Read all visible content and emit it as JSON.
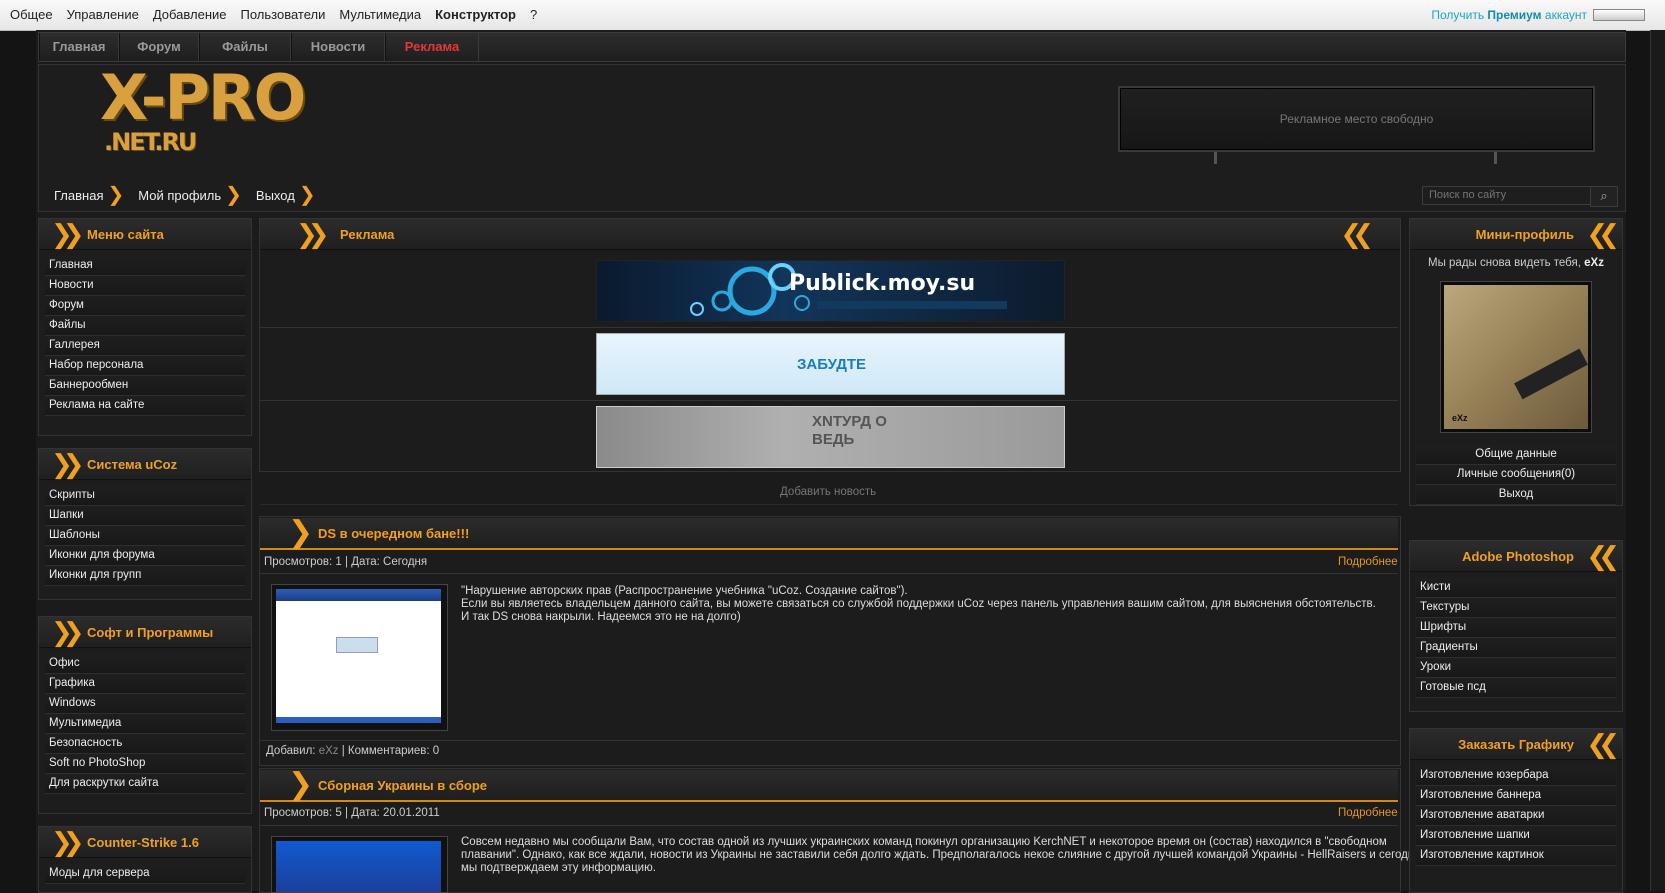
{
  "admin_bar": {
    "menu": [
      "Общее",
      "Управление",
      "Добавление",
      "Пользователи",
      "Мультимедиа",
      "Конструктор",
      "?"
    ],
    "premium_prefix": "Получить",
    "premium_bold": "Премиум",
    "premium_suffix": "аккаунт"
  },
  "top_nav": [
    "Главная",
    "Форум",
    "Файлы",
    "Новости",
    "Реклама"
  ],
  "logo": {
    "line1": "X-PRO",
    "line2": ".NET.RU"
  },
  "header_ad": "Рекламное место свободно",
  "breadcrumbs": [
    "Главная",
    "Мой профиль",
    "Выход"
  ],
  "search": {
    "placeholder": "Поиск по сайту",
    "button_icon": "magnifier-icon"
  },
  "left_blocks": [
    {
      "title": "Меню сайта",
      "items": [
        "Главная",
        "Новости",
        "Форум",
        "Файлы",
        "Галлерея",
        "Набор персонала",
        "Баннерообмен",
        "Реклама на сайте"
      ]
    },
    {
      "title": "Система uCoz",
      "items": [
        "Скрипты",
        "Шапки",
        "Шаблоны",
        "Иконки для форума",
        "Иконки для групп"
      ]
    },
    {
      "title": "Софт и Программы",
      "items": [
        "Офис",
        "Графика",
        "Windows",
        "Мультимедиа",
        "Безопасность",
        "Soft по PhotoShop",
        "Для раскрутки сайта"
      ]
    },
    {
      "title": "Counter-Strike 1.6",
      "items": [
        "Моды для сервера"
      ]
    }
  ],
  "ads_block": {
    "title": "Реклама",
    "banners": [
      "Publick.moy.su",
      "ЗАБУДТЕ",
      "ХNTУРД О ВЕДЬ"
    ]
  },
  "add_news": "Добавить новость",
  "news": [
    {
      "title": "DS в очередном бане!!!",
      "meta": "Просмотров: 1 | Дата: Сегодня",
      "more": "Подробнее",
      "text": [
        "\"Нарушение авторских прав (Распространение учебника \"uCoz. Создание сайтов\").",
        "Если вы являетесь владельцем данного сайта, вы можете связаться со службой поддержки uCoz через панель управления вашим сайтом, для выяснения обстоятельств.",
        "И так DS снова накрыли. Надеемся это не на долго)"
      ],
      "footer_prefix": "Добавил:",
      "author": "eXz",
      "footer_suffix": "| Комментариев: 0"
    },
    {
      "title": "Сборная Украины в сборе",
      "meta": "Просмотров: 5 | Дата: 20.01.2011",
      "more": "Подробнее",
      "text": [
        "Совсем недавно мы сообщали Вам, что состав одной из лучших украинских команд покинул организацию KerchNET и некоторое время он (состав) находился в \"свободном",
        "плавании\". Однако, как все ждали, новости из Украины не заставили себя долго ждать. Предполагалось некое слияние с другой лучшей командой Украины - HellRaisers и сегодня",
        "мы подтверждаем эту информацию."
      ]
    }
  ],
  "mini_profile": {
    "title": "Мини-профиль",
    "greeting": "Мы рады снова видеть тебя,",
    "user": "eXz",
    "avatar_caption": "eXz",
    "links": [
      "Общие данные",
      "Личные сообщения(0)",
      "Выход"
    ]
  },
  "right_blocks": [
    {
      "title": "Adobe Photoshop",
      "items": [
        "Кисти",
        "Текстуры",
        "Шрифты",
        "Градиенты",
        "Уроки",
        "Готовые псд"
      ]
    },
    {
      "title": "Заказать Графику",
      "items": [
        "Изготовление юзербара",
        "Изготовление баннера",
        "Изготовление аватарки",
        "Изготовление шапки",
        "Изготовление картинок"
      ]
    }
  ]
}
